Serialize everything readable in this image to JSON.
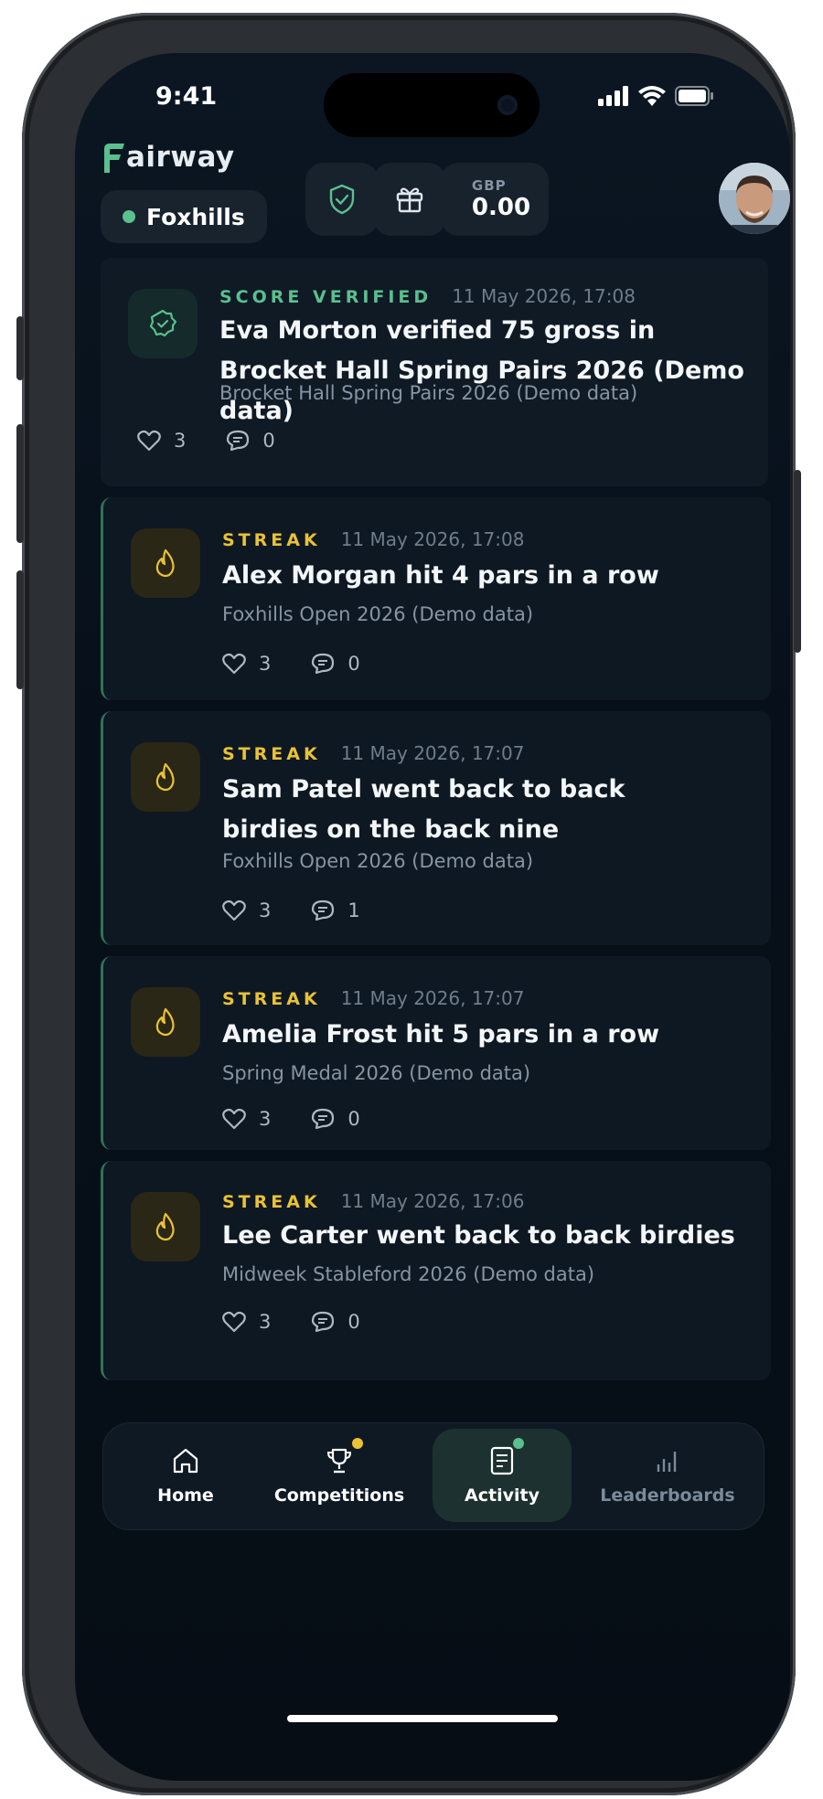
{
  "status": {
    "time": "9:41"
  },
  "app": {
    "logo_first": "F",
    "logo_rest": "airway"
  },
  "club": {
    "name": "Foxhills"
  },
  "wallet": {
    "currency": "GBP",
    "amount": "0.00"
  },
  "colors": {
    "accent": "#5ac08e",
    "streak": "#e9c235",
    "background": "#07101a"
  },
  "header": {
    "icons": [
      "shield-check-icon",
      "gift-icon",
      "wallet-icon"
    ]
  },
  "feed": [
    {
      "type": "verified",
      "tag": "SCORE VERIFIED",
      "time": "11 May 2026, 17:08",
      "title": "Eva Morton verified 75 gross in Brocket Hall Spring Pairs 2026 (Demo data)",
      "subtitle": "Brocket Hall Spring Pairs 2026 (Demo data)",
      "likes": "3",
      "comments": "0"
    },
    {
      "type": "streak",
      "tag": "STREAK",
      "time": "11 May 2026, 17:08",
      "title": "Alex Morgan hit 4 pars in a row",
      "subtitle": "Foxhills Open 2026 (Demo data)",
      "likes": "3",
      "comments": "0"
    },
    {
      "type": "streak",
      "tag": "STREAK",
      "time": "11 May 2026, 17:07",
      "title": "Sam Patel went back to back birdies on the back nine",
      "subtitle": "Foxhills Open 2026 (Demo data)",
      "likes": "3",
      "comments": "1"
    },
    {
      "type": "streak",
      "tag": "STREAK",
      "time": "11 May 2026, 17:07",
      "title": "Amelia Frost hit 5 pars in a row",
      "subtitle": "Spring Medal 2026 (Demo data)",
      "likes": "3",
      "comments": "0"
    },
    {
      "type": "streak",
      "tag": "STREAK",
      "time": "11 May 2026, 17:06",
      "title": "Lee Carter went back to back birdies",
      "subtitle": "Midweek Stableford 2026 (Demo data)",
      "likes": "3",
      "comments": "0"
    }
  ],
  "tabs": [
    {
      "label": "Home",
      "icon": "home-icon"
    },
    {
      "label": "Competitions",
      "icon": "trophy-icon"
    },
    {
      "label": "Activity",
      "icon": "activity-icon",
      "active": true
    },
    {
      "label": "Leaderboards",
      "icon": "leaderboards-icon"
    }
  ]
}
